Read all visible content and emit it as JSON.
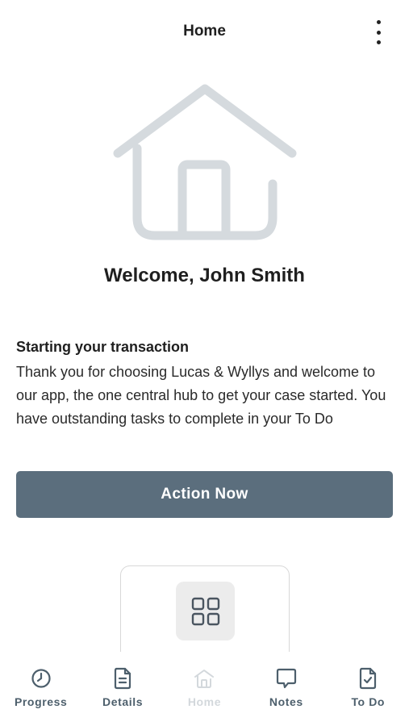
{
  "header": {
    "title": "Home",
    "menu_icon": "more-vertical-icon"
  },
  "hero": {
    "icon": "house-icon",
    "welcome": "Welcome, John Smith"
  },
  "intro": {
    "title": "Starting your transaction",
    "body": "Thank you for choosing Lucas & Wyllys and welcome to our app, the one central hub to get your case started. You have outstanding tasks to complete in your To Do"
  },
  "action_button": {
    "label": "Action Now"
  },
  "tile": {
    "icon": "grid-icon"
  },
  "bottom_nav": {
    "items": [
      {
        "label": "Progress",
        "icon": "clock-icon",
        "active": false
      },
      {
        "label": "Details",
        "icon": "document-icon",
        "active": false
      },
      {
        "label": "Home",
        "icon": "home-icon",
        "active": true
      },
      {
        "label": "Notes",
        "icon": "chat-bubble-icon",
        "active": false
      },
      {
        "label": "To Do",
        "icon": "checklist-icon",
        "active": false
      }
    ]
  },
  "colors": {
    "primary_button": "#5b6e7d",
    "nav_label": "#4d5f6c",
    "nav_active_dim": "#d3d8dc",
    "illustration": "#d5dade"
  }
}
